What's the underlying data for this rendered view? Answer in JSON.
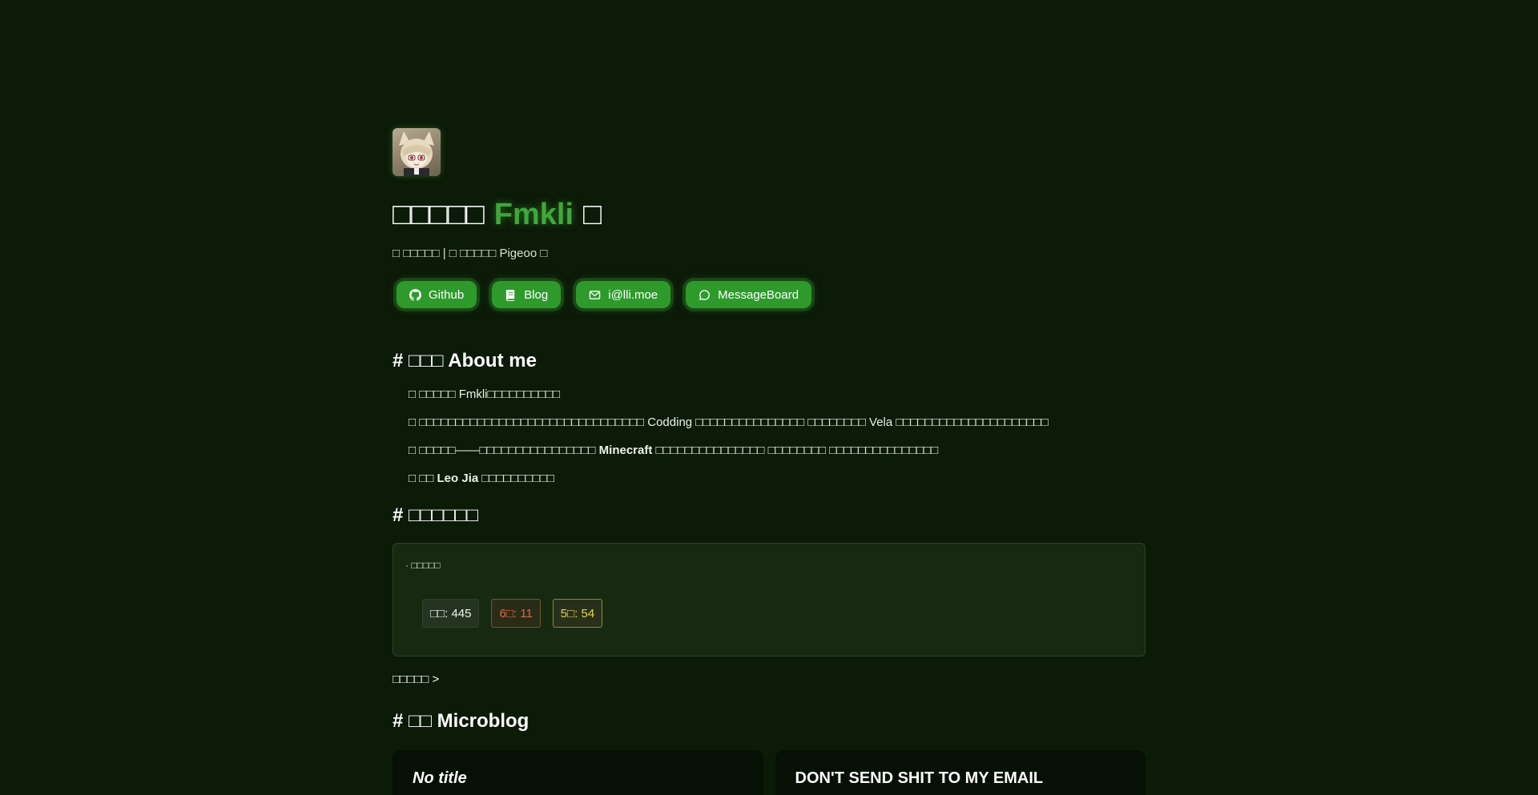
{
  "hero": {
    "title_prefix": "□□□□□",
    "name": "Fmkli",
    "title_suffix": "□",
    "tagline": "□ □□□□□ | □ □□□□□ Pigeoo □"
  },
  "links": [
    {
      "label": "Github",
      "icon": "github-icon"
    },
    {
      "label": "Blog",
      "icon": "book-icon"
    },
    {
      "label": "i@lli.moe",
      "icon": "mail-icon"
    },
    {
      "label": "MessageBoard",
      "icon": "chat-bubble-icon"
    }
  ],
  "about": {
    "heading": "# □□□ About me",
    "items": [
      {
        "pre": "□ □□□□□ Fmkli□□□□□□□□□□",
        "bold": "",
        "post": ""
      },
      {
        "pre": "□ □□□□□□□□□□□□□□□□□□□□□□□□□□□□□□□ Codding □□□□□□□□□□□□□□□ □□□□□□□□ Vela □□□□□□□□□□□□□□□□□□□□□",
        "bold": "",
        "post": ""
      },
      {
        "pre": "□ □□□□□——□□□□□□□□□□□□□□□□ ",
        "bold": "Minecraft",
        "post": " □□□□□□□□□□□□□□□ □□□□□□□□ □□□□□□□□□□□□□□□"
      },
      {
        "pre": "□ □□ ",
        "bold": "Leo Jia",
        "post": " □□□□□□□□□□"
      }
    ]
  },
  "stats": {
    "heading": "# □□□□□□",
    "subtitle": "· □□□□□",
    "total": "□□: 445",
    "six_star": "6□: 11",
    "five_star": "5□: 54",
    "more": "□□□□□ >"
  },
  "microblog": {
    "heading": "# □□ Microblog",
    "cards": [
      {
        "title": "No title"
      },
      {
        "title": "DON'T SEND SHIT TO MY EMAIL"
      }
    ]
  }
}
